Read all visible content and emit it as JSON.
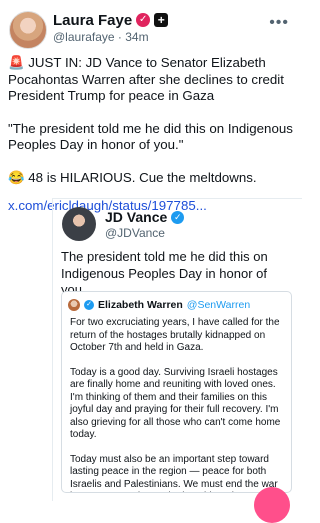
{
  "post": {
    "author_name": "Laura Faye",
    "badge_1": "✓",
    "badge_2": "+",
    "handle": "@laurafaye",
    "separator": "·",
    "time": "34m",
    "more": "•••",
    "paragraphs": [
      "🚨 JUST IN: JD Vance to Senator Elizabeth Pocahontas Warren after she declines to credit President Trump for peace in Gaza",
      "\"The president told me he did this on Indigenous Peoples Day in honor of you.\"",
      "😂 48 is HILARIOUS. Cue the meltdowns."
    ],
    "link": "x.com/ericldaugh/status/197785..."
  },
  "quote": {
    "author_name": "JD Vance",
    "verified": "✓",
    "handle": "@JDVance",
    "text": "The president told me he did this on Indigenous Peoples Day in honor of you.",
    "inner": {
      "author_name": "Elizabeth Warren",
      "verified": "✓",
      "handle": "@SenWarren",
      "paragraphs": [
        "For two excruciating years, I have called for the return of the hostages brutally kidnapped on October 7th and held in Gaza.",
        "Today is a good day. Surviving Israeli hostages are finally home and reuniting with loved ones. I'm thinking of them and their families on this joyful day and praying for their full recovery. I'm also grieving for all those who can't come home today.",
        "Today must also be an important step toward lasting peace in the region — peace for both Israelis and Palestinians. We must end the war in Gaza, surge humanitarian aid, and negotiate a two-state solution now."
      ]
    }
  },
  "colors": {
    "link": "#1d4ed8",
    "verified": "#1d9bf0",
    "badge_pink": "#e0245e",
    "fab": "#ff4f8b"
  }
}
